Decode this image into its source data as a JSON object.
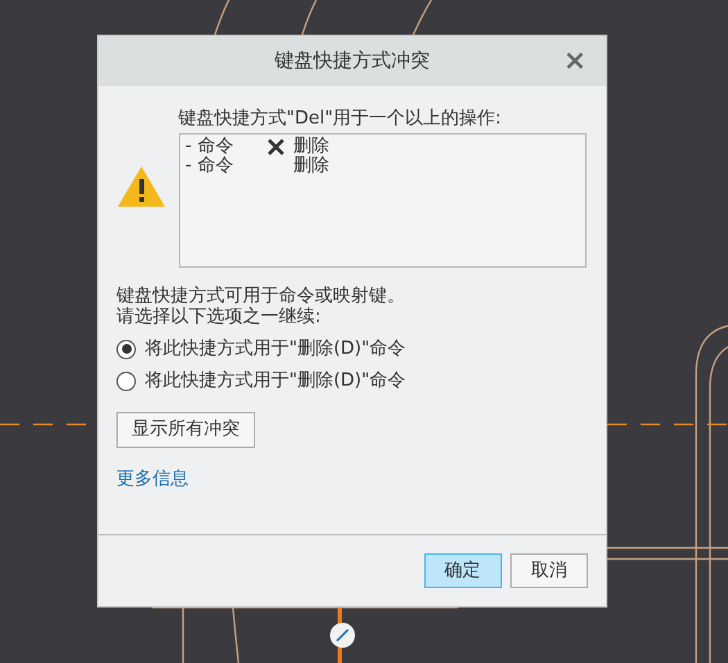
{
  "window": {
    "title": "键盘快捷方式冲突",
    "close": "×"
  },
  "conflict_label": "键盘快捷方式\"Del\"用于一个以上的操作:",
  "conflicts": [
    {
      "prefix": "- 命令",
      "has_icon": true,
      "label": "删除"
    },
    {
      "prefix": "- 命令",
      "has_icon": false,
      "label": "删除"
    }
  ],
  "info": [
    "键盘快捷方式可用于命令或映射键。",
    "请选择以下选项之一继续:"
  ],
  "options": [
    {
      "label": "将此快捷方式用于\"删除(D)\"命令",
      "selected": true
    },
    {
      "label": "将此快捷方式用于\"删除(D)\"命令",
      "selected": false
    }
  ],
  "show_all_button": "显示所有冲突",
  "more_info_link": "更多信息",
  "buttons": [
    {
      "label": "确定",
      "primary": true
    },
    {
      "label": "取消",
      "primary": false
    }
  ]
}
